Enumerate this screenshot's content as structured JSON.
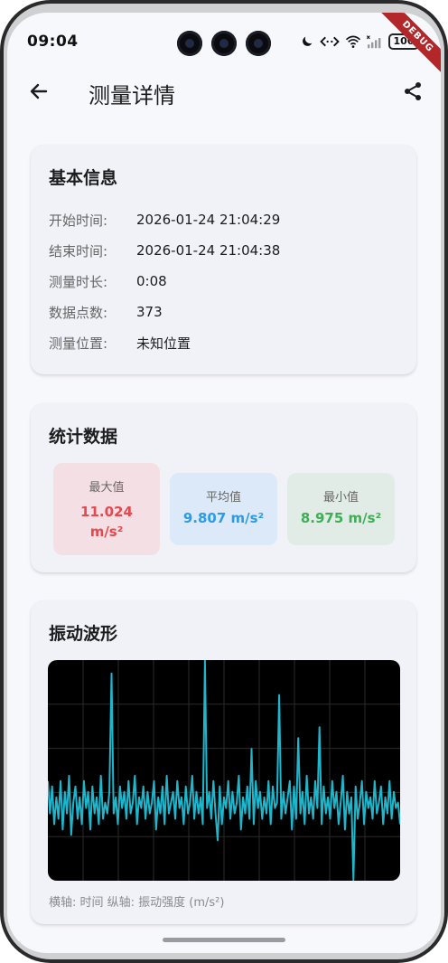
{
  "status_bar": {
    "time": "09:04",
    "battery": "100",
    "debug_banner": "DEBUG",
    "icons": [
      "moon-icon",
      "data-arrows-icon",
      "wifi-icon",
      "signal-icon",
      "battery-icon"
    ]
  },
  "app_bar": {
    "title": "测量详情",
    "back_icon": "arrow-left-icon",
    "share_icon": "share-icon"
  },
  "basic_info": {
    "title": "基本信息",
    "rows": [
      {
        "label": "开始时间:",
        "value": "2026-01-24 21:04:29"
      },
      {
        "label": "结束时间:",
        "value": "2026-01-24 21:04:38"
      },
      {
        "label": "测量时长:",
        "value": "0:08"
      },
      {
        "label": "数据点数:",
        "value": "373"
      },
      {
        "label": "测量位置:",
        "value": "未知位置"
      }
    ]
  },
  "statistics": {
    "title": "统计数据",
    "max": {
      "label": "最大值",
      "value": "11.024 m/s²",
      "color": "#e5484d",
      "bg": "#f4dfe4"
    },
    "avg": {
      "label": "平均值",
      "value": "9.807 m/s²",
      "color": "#2e9be6",
      "bg": "#dbe9f8"
    },
    "min": {
      "label": "最小值",
      "value": "8.975 m/s²",
      "color": "#3fae54",
      "bg": "#e1ece6"
    }
  },
  "waveform": {
    "title": "振动波形",
    "caption": "横轴: 时间  纵轴: 振动强度 (m/s²)",
    "line_color": "#1fb6cc",
    "background": "#000000"
  },
  "chart_data": {
    "type": "line",
    "series": [
      {
        "values": [
          9.9,
          9.6,
          9.85,
          9.5,
          9.75,
          9.55,
          9.9,
          9.45,
          9.8,
          9.6,
          9.95,
          9.4,
          9.7,
          9.85,
          9.55,
          9.75,
          9.5,
          9.9,
          9.65,
          9.8,
          9.45,
          9.85,
          9.6,
          9.75,
          9.5,
          9.95,
          9.55,
          9.7,
          9.6,
          9.8,
          10.9,
          9.6,
          9.75,
          9.5,
          9.85,
          9.65,
          9.8,
          9.55,
          9.9,
          9.6,
          9.7,
          9.95,
          9.5,
          9.75,
          9.65,
          9.85,
          9.55,
          9.8,
          9.6,
          9.7,
          9.9,
          9.45,
          9.75,
          9.6,
          9.85,
          9.5,
          9.95,
          9.6,
          9.7,
          9.8,
          9.55,
          9.9,
          9.65,
          9.75,
          9.5,
          9.85,
          9.6,
          9.7,
          9.95,
          9.55,
          9.8,
          9.6,
          9.75,
          9.5,
          11.02,
          9.65,
          9.8,
          9.55,
          9.9,
          9.6,
          9.35,
          9.85,
          9.5,
          9.75,
          9.65,
          9.9,
          9.55,
          9.8,
          9.6,
          9.7,
          9.95,
          9.45,
          9.75,
          9.6,
          9.85,
          9.55,
          10.2,
          9.5,
          9.9,
          9.65,
          9.8,
          9.55,
          9.75,
          9.6,
          9.9,
          9.5,
          9.85,
          9.65,
          9.7,
          10.7,
          9.55,
          9.8,
          9.6,
          9.75,
          9.9,
          9.45,
          9.85,
          9.55,
          10.3,
          9.6,
          9.8,
          9.5,
          9.95,
          9.6,
          9.75,
          9.55,
          9.9,
          9.65,
          10.4,
          9.5,
          9.85,
          9.6,
          9.75,
          9.55,
          9.9,
          9.65,
          9.8,
          9.5,
          9.7,
          9.95,
          9.45,
          9.8,
          9.6,
          9.75,
          8.98,
          9.85,
          9.55,
          9.7,
          9.9,
          9.5,
          9.8,
          9.65,
          9.75,
          9.55,
          9.9,
          9.6,
          9.7,
          9.85,
          9.5,
          9.75,
          9.6,
          9.9,
          9.55,
          9.8,
          9.65,
          9.7,
          9.5
        ]
      }
    ],
    "ylim": [
      8.975,
      11.024
    ],
    "grid": true
  },
  "home_indicator": "home-indicator"
}
